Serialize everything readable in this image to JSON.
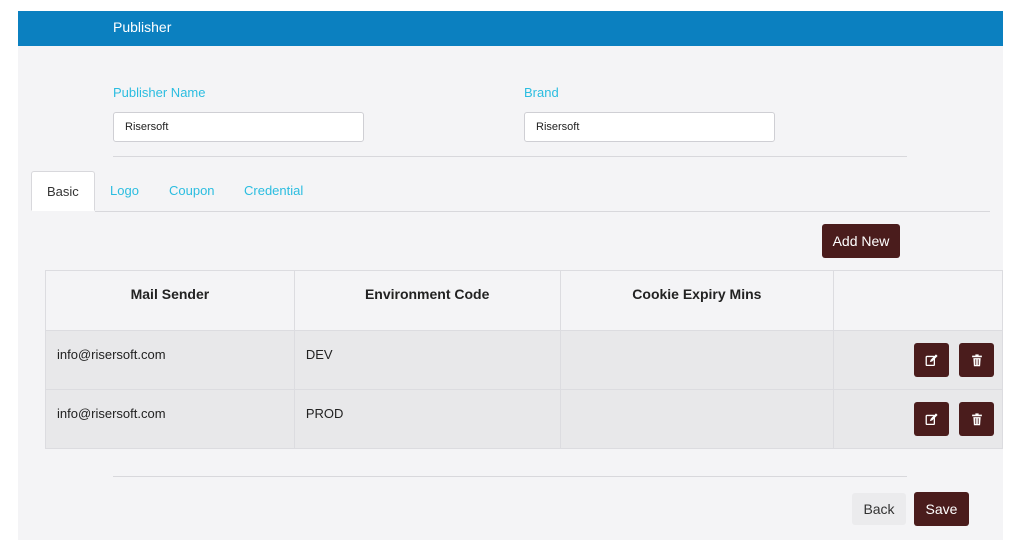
{
  "header": {
    "title": "Publisher"
  },
  "form": {
    "publisher_name": {
      "label": "Publisher Name",
      "value": "Risersoft"
    },
    "brand": {
      "label": "Brand",
      "value": "Risersoft"
    }
  },
  "tabs": [
    {
      "label": "Basic",
      "active": true
    },
    {
      "label": "Logo"
    },
    {
      "label": "Coupon"
    },
    {
      "label": "Credential"
    }
  ],
  "toolbar": {
    "add_new_label": "Add New"
  },
  "table": {
    "columns": [
      "Mail Sender",
      "Environment Code",
      "Cookie Expiry Mins",
      ""
    ],
    "rows": [
      {
        "mail_sender": "info@risersoft.com",
        "environment_code": "DEV",
        "cookie_expiry_mins": ""
      },
      {
        "mail_sender": "info@risersoft.com",
        "environment_code": "PROD",
        "cookie_expiry_mins": ""
      }
    ],
    "row_actions": {
      "edit_icon": "edit-icon",
      "delete_icon": "trash-icon"
    }
  },
  "footer": {
    "back_label": "Back",
    "save_label": "Save"
  },
  "colors": {
    "header": "#0b80c0",
    "accent_text": "#2bbde0",
    "button_dark": "#4a1c1c"
  }
}
